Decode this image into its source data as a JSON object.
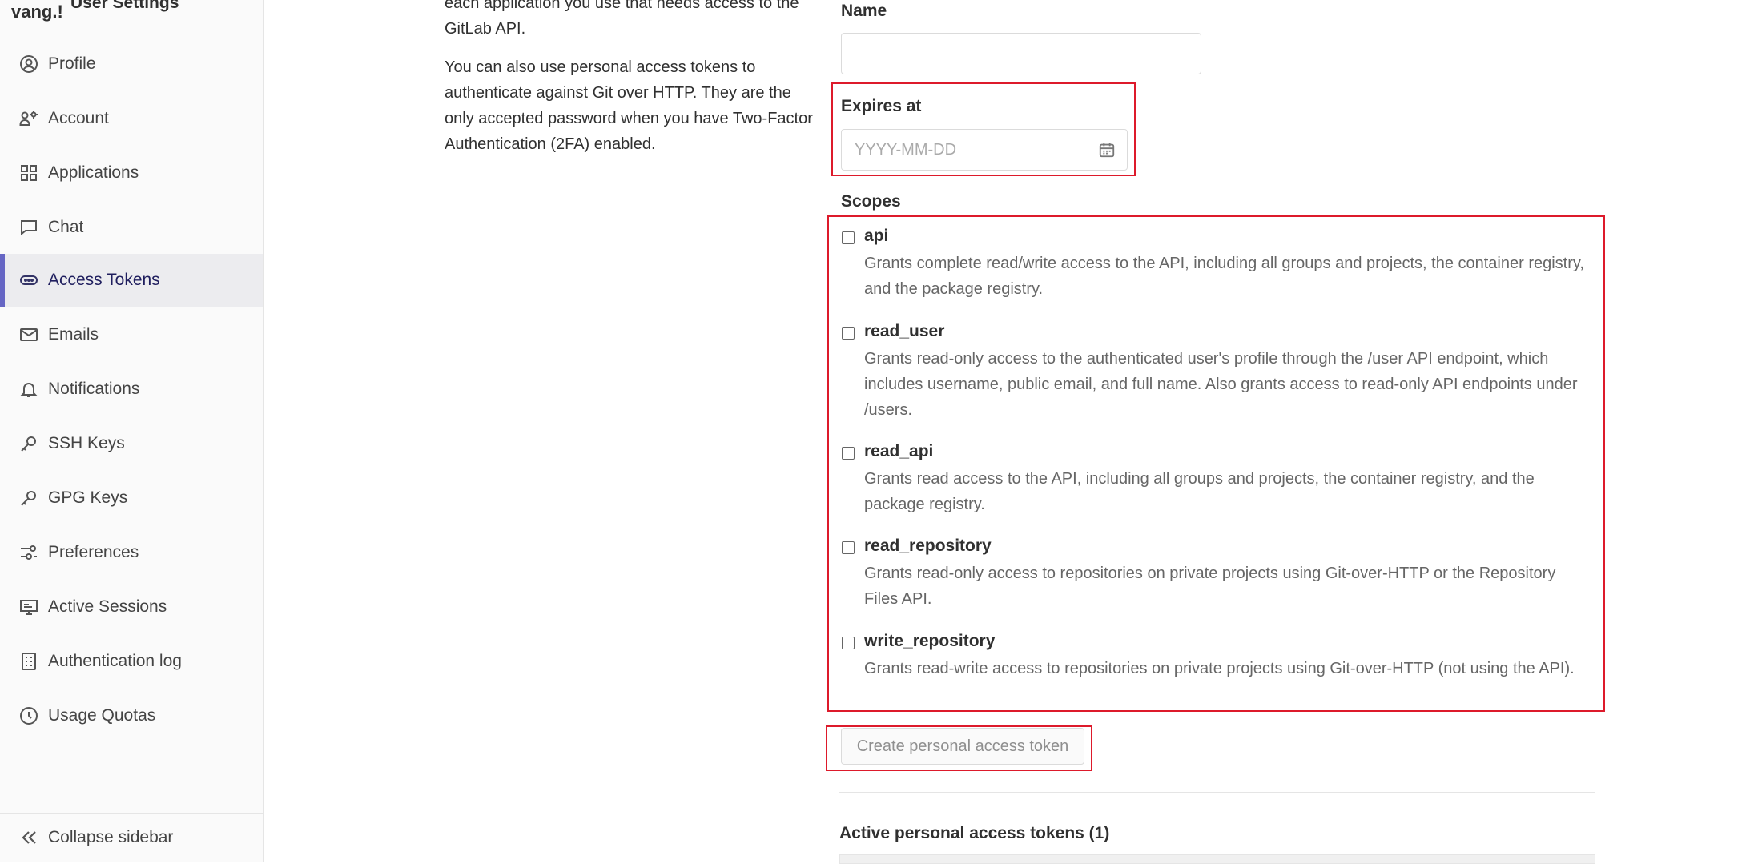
{
  "sidebar": {
    "user_fragment": "vang.!",
    "title": "User Settings",
    "items": [
      {
        "label": "Profile",
        "icon": "profile-icon"
      },
      {
        "label": "Account",
        "icon": "account-icon"
      },
      {
        "label": "Applications",
        "icon": "applications-icon"
      },
      {
        "label": "Chat",
        "icon": "chat-icon"
      },
      {
        "label": "Access Tokens",
        "icon": "token-icon",
        "active": true
      },
      {
        "label": "Emails",
        "icon": "mail-icon"
      },
      {
        "label": "Notifications",
        "icon": "bell-icon"
      },
      {
        "label": "SSH Keys",
        "icon": "key-icon"
      },
      {
        "label": "GPG Keys",
        "icon": "key-icon"
      },
      {
        "label": "Preferences",
        "icon": "preferences-icon"
      },
      {
        "label": "Active Sessions",
        "icon": "monitor-icon"
      },
      {
        "label": "Authentication log",
        "icon": "log-icon"
      },
      {
        "label": "Usage Quotas",
        "icon": "quota-icon"
      }
    ],
    "collapse_label": "Collapse sidebar"
  },
  "description": {
    "p1": "each application you use that needs access to the GitLab API.",
    "p2": "You can also use personal access tokens to authenticate against Git over HTTP. They are the only accepted password when you have Two-Factor Authentication (2FA) enabled."
  },
  "form": {
    "name_label": "Name",
    "name_value": "",
    "expires_label": "Expires at",
    "expires_placeholder": "YYYY-MM-DD",
    "scopes_label": "Scopes",
    "scopes": [
      {
        "name": "api",
        "help": "Grants complete read/write access to the API, including all groups and projects, the container registry, and the package registry."
      },
      {
        "name": "read_user",
        "help": "Grants read-only access to the authenticated user's profile through the /user API endpoint, which includes username, public email, and full name. Also grants access to read-only API endpoints under /users."
      },
      {
        "name": "read_api",
        "help": "Grants read access to the API, including all groups and projects, the container registry, and the package registry."
      },
      {
        "name": "read_repository",
        "help": "Grants read-only access to repositories on private projects using Git-over-HTTP or the Repository Files API."
      },
      {
        "name": "write_repository",
        "help": "Grants read-write access to repositories on private projects using Git-over-HTTP (not using the API)."
      }
    ],
    "submit_label": "Create personal access token"
  },
  "active_tokens": {
    "title": "Active personal access tokens (1)"
  },
  "colors": {
    "highlight": "#dd1a2b",
    "active_nav_bar": "#6666c4",
    "active_nav_text": "#1f1e5e"
  }
}
